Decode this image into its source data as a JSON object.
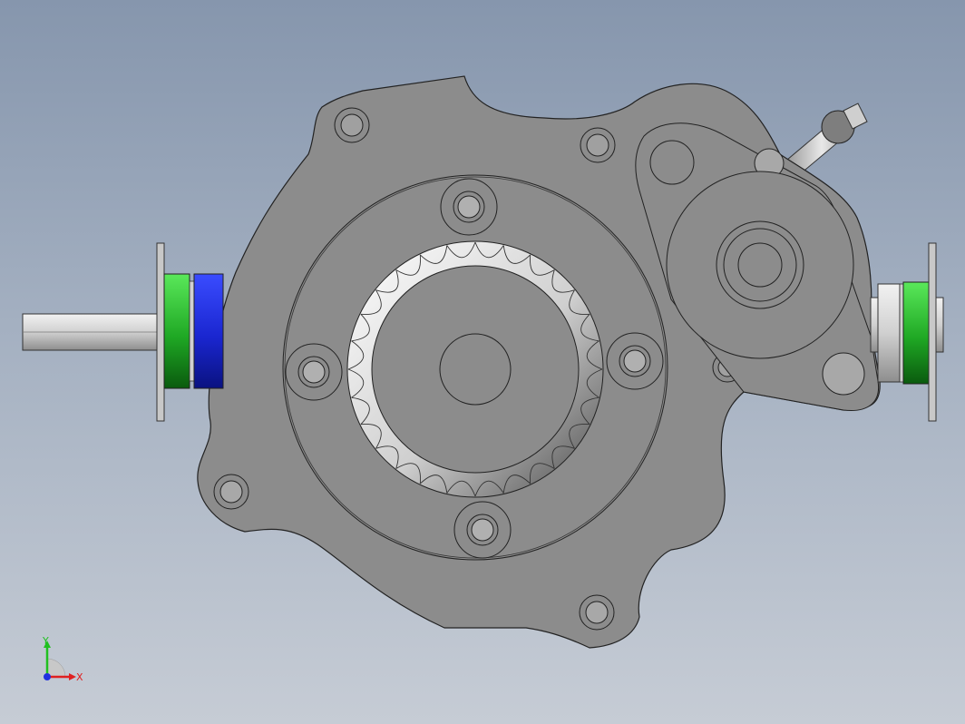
{
  "viewport": {
    "background_top": "#8696ad",
    "background_bottom": "#c6ccd5"
  },
  "model": {
    "housing_color": "#8c8c8c",
    "edge_color": "#222222",
    "bearing_green": "#22b02a",
    "bearing_blue": "#1f2fd6",
    "shaft_color": "#d9d9d9"
  },
  "triad": {
    "x_label": "X",
    "y_label": "Y",
    "x_color": "#e02020",
    "y_color": "#20c020",
    "z_color": "#2030e0"
  }
}
